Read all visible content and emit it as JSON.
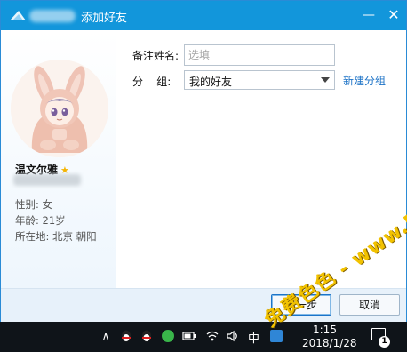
{
  "window": {
    "title": "添加好友",
    "minimize_symbol": "—",
    "close_symbol": "✕"
  },
  "profile": {
    "nickname": "温文尔雅",
    "gender": "性别: 女",
    "age": "年龄: 21岁",
    "location": "所在地: 北京  朝阳"
  },
  "form": {
    "remark_label": "备注姓名:",
    "remark_placeholder": "选填",
    "group_label": "分    组:",
    "group_value": "我的好友",
    "new_group_link": "新建分组"
  },
  "buttons": {
    "next": "下一步",
    "cancel": "取消"
  },
  "taskbar": {
    "up_arrow": "∧",
    "ime": "中",
    "time": "1:15",
    "date": "2018/1/28",
    "notification_count": "1"
  },
  "watermark": {
    "text": "免费色色 - www.MFsese.com"
  },
  "colors": {
    "titlebar": "#1296db",
    "link": "#1f74c7",
    "footer": "#e7f1fa",
    "taskbar": "#0f1419",
    "watermark": "#f2c200"
  }
}
